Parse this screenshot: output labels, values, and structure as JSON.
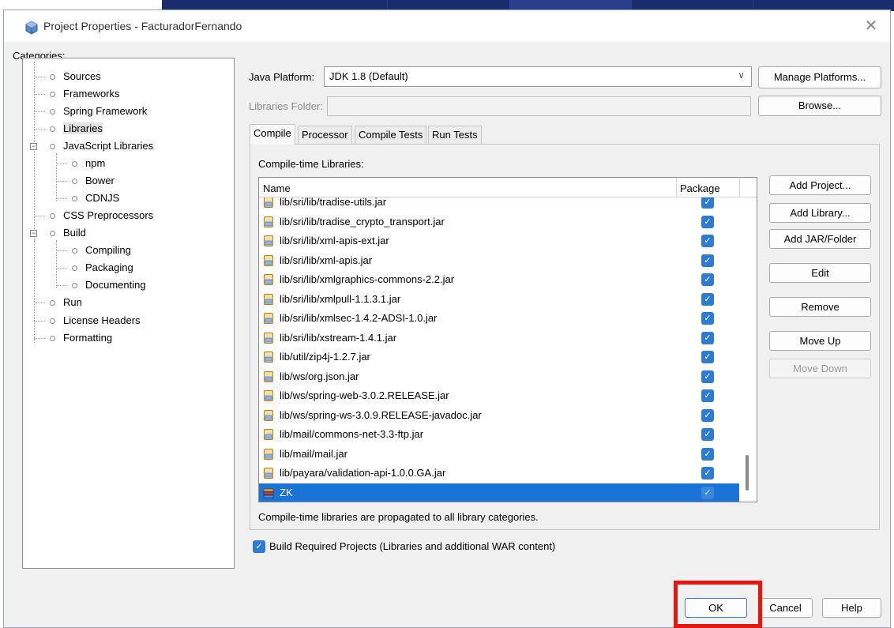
{
  "window": {
    "title": "Project Properties - FacturadorFernando",
    "close_glyph": "✕"
  },
  "categories": {
    "label": "Categories:",
    "items": [
      {
        "label": "Sources"
      },
      {
        "label": "Frameworks"
      },
      {
        "label": "Spring Framework"
      },
      {
        "label": "Libraries"
      },
      {
        "label": "JavaScript Libraries"
      },
      {
        "label": "npm"
      },
      {
        "label": "Bower"
      },
      {
        "label": "CDNJS"
      },
      {
        "label": "CSS Preprocessors"
      },
      {
        "label": "Build"
      },
      {
        "label": "Compiling"
      },
      {
        "label": "Packaging"
      },
      {
        "label": "Documenting"
      },
      {
        "label": "Run"
      },
      {
        "label": "License Headers"
      },
      {
        "label": "Formatting"
      }
    ]
  },
  "platform": {
    "label": "Java Platform:",
    "value": "JDK 1.8 (Default)",
    "manage_button": "Manage Platforms...",
    "libraries_folder_label": "Libraries Folder:",
    "browse_button": "Browse..."
  },
  "tabs": [
    "Compile",
    "Processor",
    "Compile Tests",
    "Run Tests"
  ],
  "compile": {
    "section_label": "Compile-time Libraries:",
    "columns": {
      "name": "Name",
      "package": "Package"
    },
    "rows": [
      {
        "name": "lib/sri/lib/tradise-utils.jar"
      },
      {
        "name": "lib/sri/lib/tradise_crypto_transport.jar"
      },
      {
        "name": "lib/sri/lib/xml-apis-ext.jar"
      },
      {
        "name": "lib/sri/lib/xml-apis.jar"
      },
      {
        "name": "lib/sri/lib/xmlgraphics-commons-2.2.jar"
      },
      {
        "name": "lib/sri/lib/xmlpull-1.1.3.1.jar"
      },
      {
        "name": "lib/sri/lib/xmlsec-1.4.2-ADSI-1.0.jar"
      },
      {
        "name": "lib/sri/lib/xstream-1.4.1.jar"
      },
      {
        "name": "lib/util/zip4j-1.2.7.jar"
      },
      {
        "name": "lib/ws/org.json.jar"
      },
      {
        "name": "lib/ws/spring-web-3.0.2.RELEASE.jar"
      },
      {
        "name": "lib/ws/spring-ws-3.0.9.RELEASE-javadoc.jar"
      },
      {
        "name": "lib/mail/commons-net-3.3-ftp.jar"
      },
      {
        "name": "lib/mail/mail.jar"
      },
      {
        "name": "lib/payara/validation-api-1.0.0.GA.jar"
      },
      {
        "name": "ZK"
      }
    ],
    "note": "Compile-time libraries are propagated to all library categories.",
    "buttons": {
      "add_project": "Add Project...",
      "add_library": "Add Library...",
      "add_jar": "Add JAR/Folder",
      "edit": "Edit",
      "remove": "Remove",
      "move_up": "Move Up",
      "move_down": "Move Down"
    }
  },
  "build_required": {
    "label": "Build Required Projects (Libraries and additional WAR content)",
    "checked": true
  },
  "footer": {
    "ok": "OK",
    "cancel": "Cancel",
    "help": "Help"
  },
  "colors": {
    "selection": "#1a73d6",
    "checkbox": "#2e7cd1",
    "highlight_border": "#e8140f",
    "top_bar": "#1a2b6e"
  },
  "icons": {
    "checkmark": "✓",
    "expand_minus": "−",
    "chevron": "∨"
  }
}
